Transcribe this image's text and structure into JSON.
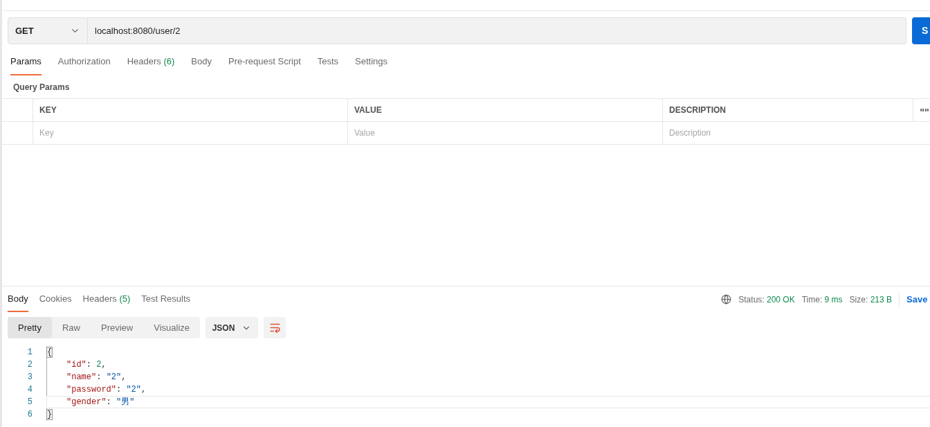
{
  "request": {
    "method": "GET",
    "url": "localhost:8080/user/2",
    "send_label": "S"
  },
  "request_tabs": [
    {
      "label": "Params",
      "selected": true
    },
    {
      "label": "Authorization",
      "selected": false
    },
    {
      "label": "Headers",
      "count": "(6)",
      "selected": false
    },
    {
      "label": "Body",
      "selected": false
    },
    {
      "label": "Pre-request Script",
      "selected": false
    },
    {
      "label": "Tests",
      "selected": false
    },
    {
      "label": "Settings",
      "selected": false
    }
  ],
  "query_params": {
    "title": "Query Params",
    "columns": [
      "KEY",
      "VALUE",
      "DESCRIPTION"
    ],
    "placeholders": [
      "Key",
      "Value",
      "Description"
    ]
  },
  "response_tabs": [
    {
      "label": "Body",
      "selected": true
    },
    {
      "label": "Cookies",
      "selected": false
    },
    {
      "label": "Headers",
      "count": "(5)",
      "selected": false
    },
    {
      "label": "Test Results",
      "selected": false
    }
  ],
  "status": {
    "status_label": "Status:",
    "status_value": "200 OK",
    "time_label": "Time:",
    "time_value": "9 ms",
    "size_label": "Size:",
    "size_value": "213 B",
    "save_label": "Save"
  },
  "view_modes": [
    {
      "label": "Pretty",
      "selected": true
    },
    {
      "label": "Raw",
      "selected": false
    },
    {
      "label": "Preview",
      "selected": false
    },
    {
      "label": "Visualize",
      "selected": false
    }
  ],
  "format": "JSON",
  "code_lines": [
    {
      "number": "1",
      "tokens": [
        {
          "kind": "brace",
          "text": "{"
        }
      ]
    },
    {
      "number": "2",
      "tokens": [
        {
          "kind": "key",
          "text": "\"id\""
        },
        {
          "kind": "punct",
          "text": ": "
        },
        {
          "kind": "number",
          "text": "2"
        },
        {
          "kind": "punct",
          "text": ","
        }
      ]
    },
    {
      "number": "3",
      "tokens": [
        {
          "kind": "key",
          "text": "\"name\""
        },
        {
          "kind": "punct",
          "text": ": "
        },
        {
          "kind": "string",
          "text": "\"2\""
        },
        {
          "kind": "punct",
          "text": ","
        }
      ]
    },
    {
      "number": "4",
      "tokens": [
        {
          "kind": "key",
          "text": "\"password\""
        },
        {
          "kind": "punct",
          "text": ": "
        },
        {
          "kind": "string",
          "text": "\"2\""
        },
        {
          "kind": "punct",
          "text": ","
        }
      ]
    },
    {
      "number": "5",
      "current": true,
      "tokens": [
        {
          "kind": "key",
          "text": "\"gender\""
        },
        {
          "kind": "punct",
          "text": ": "
        },
        {
          "kind": "string",
          "text": "\"男\""
        }
      ]
    },
    {
      "number": "6",
      "tokens": [
        {
          "kind": "brace",
          "text": "}"
        }
      ]
    }
  ]
}
